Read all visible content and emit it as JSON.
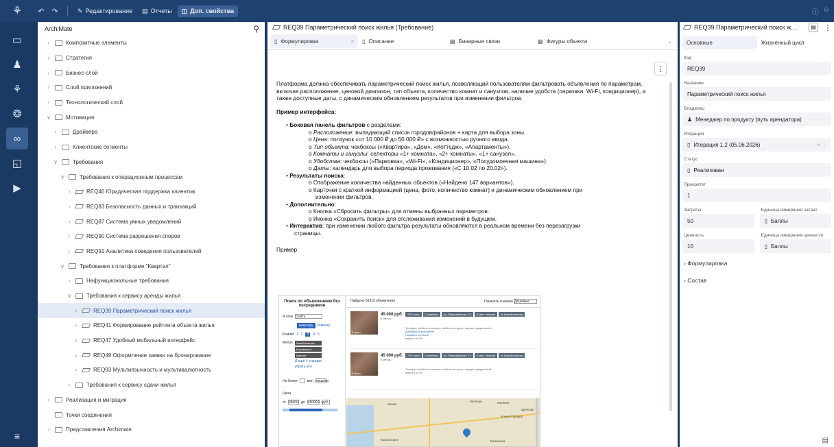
{
  "topbar": {
    "edit": "Редактирование",
    "reports": "Отчеты",
    "extra": "Доп. свойства"
  },
  "tree": {
    "title": "ArchiMate",
    "nodes": [
      {
        "label": "Композитные элементы",
        "depth": 0,
        "kind": "folder",
        "state": "collapsed"
      },
      {
        "label": "Стратегия",
        "depth": 0,
        "kind": "folder",
        "state": "collapsed"
      },
      {
        "label": "Бизнес-слой",
        "depth": 0,
        "kind": "folder",
        "state": "collapsed"
      },
      {
        "label": "Слой приложений",
        "depth": 0,
        "kind": "folder",
        "state": "collapsed"
      },
      {
        "label": "Технологический слой",
        "depth": 0,
        "kind": "folder",
        "state": "collapsed"
      },
      {
        "label": "Мотивация",
        "depth": 0,
        "kind": "folder",
        "state": "expanded"
      },
      {
        "label": "Драйвера",
        "depth": 1,
        "kind": "folder",
        "state": "collapsed"
      },
      {
        "label": "Клиентские сегменты",
        "depth": 1,
        "kind": "folder",
        "state": "collapsed"
      },
      {
        "label": "Требования",
        "depth": 1,
        "kind": "folder",
        "state": "expanded"
      },
      {
        "label": "Требования к операционным процессам",
        "depth": 2,
        "kind": "folder",
        "state": "expanded"
      },
      {
        "label": "REQ46 Юридическая поддержка клиентов",
        "depth": 3,
        "kind": "req",
        "state": "collapsed"
      },
      {
        "label": "REQ83 Безопасность данных и транзакций",
        "depth": 3,
        "kind": "req",
        "state": "collapsed"
      },
      {
        "label": "REQ87 Система умных уведомлений",
        "depth": 3,
        "kind": "req",
        "state": "collapsed"
      },
      {
        "label": "REQ90 Система разрешения споров",
        "depth": 3,
        "kind": "req",
        "state": "collapsed"
      },
      {
        "label": "REQ91 Аналитика поведения пользователей",
        "depth": 3,
        "kind": "req",
        "state": "collapsed"
      },
      {
        "label": "Требования к платформе \"Квартал\"",
        "depth": 2,
        "kind": "folder",
        "state": "expanded"
      },
      {
        "label": "Нефункциональные требования",
        "depth": 3,
        "kind": "folder",
        "state": "collapsed"
      },
      {
        "label": "Требования к сервису аренды жилья",
        "depth": 3,
        "kind": "folder",
        "state": "expanded"
      },
      {
        "label": "REQ39 Параметрический поиск жилья",
        "depth": 4,
        "kind": "req",
        "state": "collapsed",
        "selected": true
      },
      {
        "label": "REQ41 Формирование рейтинга объекта жилья",
        "depth": 4,
        "kind": "req",
        "state": "collapsed"
      },
      {
        "label": "REQ47 Удобный мобильный интерфейс",
        "depth": 4,
        "kind": "req",
        "state": "collapsed"
      },
      {
        "label": "REQ49 Оформление заявки на бронирование",
        "depth": 4,
        "kind": "req",
        "state": "collapsed"
      },
      {
        "label": "REQ93 Мультиязычность и мультивалютность",
        "depth": 4,
        "kind": "req",
        "state": "collapsed"
      },
      {
        "label": "Требования к сервису сдачи жилья",
        "depth": 3,
        "kind": "folder",
        "state": "collapsed"
      },
      {
        "label": "Реализация и миграция",
        "depth": 0,
        "kind": "folder",
        "state": "collapsed"
      },
      {
        "label": "Точки соединения",
        "depth": 0,
        "kind": "folder",
        "state": "none"
      },
      {
        "label": "Представления Archimate",
        "depth": 0,
        "kind": "folder",
        "state": "collapsed"
      }
    ]
  },
  "doc": {
    "title": "REQ39 Параметрический поиск жилья (Требование)",
    "tabs": [
      "Формулировка",
      "Описание",
      "Бинарные связи",
      "Фигуры объекта"
    ],
    "intro": "Платформа должна обеспечивать параметрический поиск жилья, позволяющий пользователям фильтровать объявления по параметрам, включая расположение, ценовой диапазон, тип объекта, количество комнат и санузлов, наличие удобств (парковка, Wi-Fi, кондиционер), а также доступные даты, с динамическим обновлением результатов при изменении фильтров.",
    "example_heading": "Пример интерфейса:",
    "b1_title": "Боковая панель фильтров",
    "b1_rest": " с разделами:",
    "b1_items": [
      {
        "em": "Расположение",
        "rest": ": выпадающий список городов/районов + карта для выбора зоны."
      },
      {
        "em": "Цена",
        "rest": ": ползунок «от 10 000 ₽ до 50 000 ₽» с возможностью ручного ввода."
      },
      {
        "em": "Тип объекта",
        "rest": ": чекбоксы («Квартира», «Дом», «Коттедж», «Апартаменты»)."
      },
      {
        "em": "Комнаты и санузлы",
        "rest": ": селекторы «1+ комната», «2+ комнаты», «1+ санузел»."
      },
      {
        "em": "Удобства",
        "rest": ": чекбоксы («Парковка», «Wi-Fi», «Кондиционер», «Посудомоечная машина»)."
      },
      {
        "em": "Даты",
        "rest": ": календарь для выбора периода проживания («С 10.02 по 20.02»)."
      }
    ],
    "b2_title": "Результаты поиска",
    "b2_items": [
      "Отображение количества найденных объектов («Найдено 147 вариантов»).",
      "Карточки с краткой информацией (цена, фото, количество комнат) и динамическим обновлением при",
      "изменении фильтров."
    ],
    "b3_title": "Дополнительно",
    "b3_items": [
      "Кнопка «Сбросить фильтры» для отмены выбранных параметров.",
      "Иконка «Сохранить поиск» для отслеживания изменений в будущем."
    ],
    "b4_title": "Интерактив",
    "b4_rest": ": при изменении любого фильтра результаты обновляются в реальном времени без перезагрузки",
    "b4_rest2": "страницы.",
    "sample_label": "Пример",
    "mock": {
      "side_title": "Поиск по объявлениям без посредников",
      "want": "Я хочу",
      "want_val": "Снять",
      "rent_a": "квартиру",
      "rent_b": "комнату",
      "rooms_label": "Комнат",
      "rooms": [
        "1",
        "2",
        "3",
        "4",
        "5"
      ],
      "metro_label": "Метро",
      "metro": [
        "Измайловская",
        "Боровицкая",
        "Курская"
      ],
      "more_metro": "И ещё 4 станции",
      "clear": "убрать все",
      "not_more": "Не более",
      "min_walk": "мин",
      "walk": "пешком",
      "price_label": "Цена",
      "from": "от",
      "price_from": "36000",
      "to": "до",
      "price_to": "450000",
      "cur": "руб",
      "found": "Найдено 56312 объявления",
      "sort_label": "Показать сначала",
      "sort_val": "Дешевые",
      "cards": [
        {
          "price": "45 000 руб.",
          "unit": "в месяц",
          "tags": [
            "7/12 этаж",
            "2 комнаты",
            "ул. Первомайская, 13",
            "5 мин. пешком",
            "м. Измайловская"
          ],
          "desc": "Телефон, мебель в комнате, мебель на кухне, санузел раздельный...",
          "fav": "Добавить в избранное",
          "map": "Показать на карте",
          "time": "вчера в 19:00",
          "photos": "5 фото"
        },
        {
          "price": "45 000 руб.",
          "unit": "в месяц",
          "tags": [
            "7/12 этаж",
            "2 комнаты",
            "ул. Первомайская, 13",
            "5 мин. пешком",
            "м. Измайловская"
          ],
          "desc": "Телефон, мебель в комнате, мебель на кухне, санузел раздельный...",
          "fav": "",
          "map": "",
          "time": "вчера в 19:00",
          "photos": "5 фото"
        }
      ],
      "map_labels": [
        "Химки",
        "Мытищи",
        "Королев",
        "Щелково",
        "Красногорск",
        "Балашиха",
        "Новый Городок"
      ]
    }
  },
  "props": {
    "title": "REQ39 Параметрический поиск ж...",
    "tabs": [
      "Основные",
      "Жизненный цикл"
    ],
    "code_label": "Код",
    "code": "REQ39",
    "name_label": "Название",
    "name": "Параметрический поиск жилья",
    "owner_label": "Владелец",
    "owner": "Менеджер по продукту (путь арендатора)",
    "iteration_label": "Итерация",
    "iteration": "Итерация 1.2 (05.06.2026)",
    "status_label": "Статус",
    "status": "Реализован",
    "priority_label": "Приоритет",
    "priority": "1",
    "cost_label": "Затраты",
    "cost": "50",
    "cost_unit_label": "Единица измерения затрат",
    "cost_unit": "Баллы",
    "value_label": "Ценность",
    "value": "10",
    "value_unit_label": "Единица измерения ценности",
    "value_unit": "Баллы",
    "sect1": "Формулировка",
    "sect2": "Состав"
  }
}
